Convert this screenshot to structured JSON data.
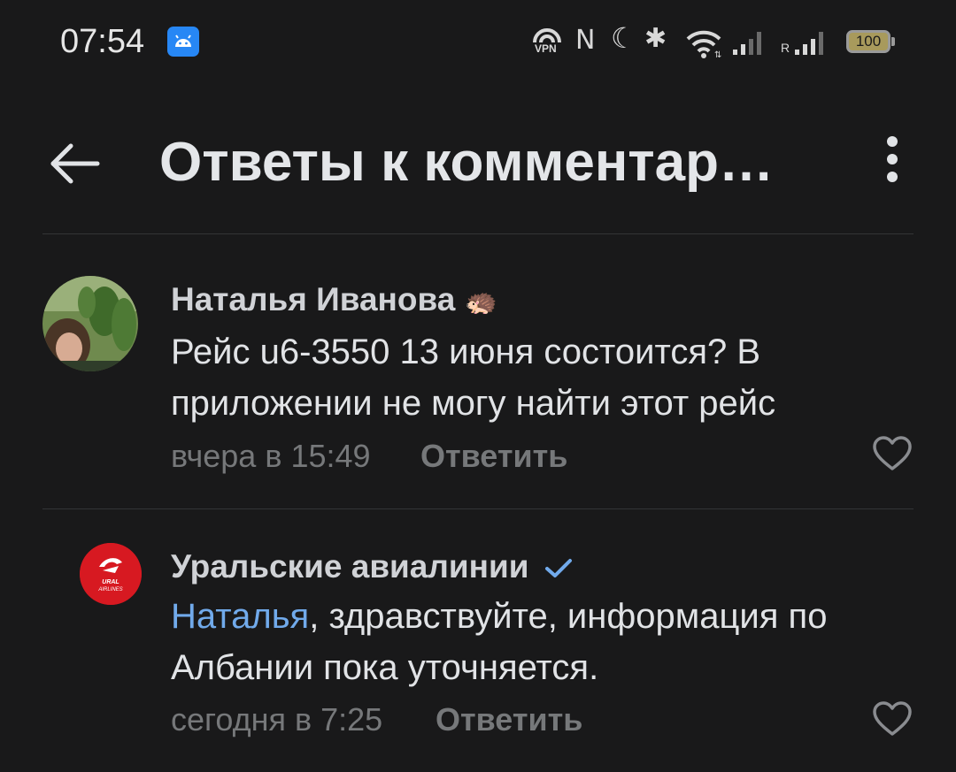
{
  "status_bar": {
    "time": "07:54",
    "vpn_label": "VPN",
    "nfc_glyph": "N",
    "moon_glyph": "☾",
    "bluetooth_glyph": "✱",
    "roaming_label": "R",
    "battery_level": "100",
    "icons": [
      "android-notification-icon",
      "vpn-icon",
      "nfc-icon",
      "do-not-disturb-icon",
      "bluetooth-icon",
      "wifi-icon",
      "signal-icon",
      "roaming-signal-icon",
      "battery-icon"
    ]
  },
  "header": {
    "title": "Ответы к комментарию",
    "back_icon": "arrow-left-icon",
    "more_icon": "more-vertical-icon"
  },
  "comments": [
    {
      "author": "Наталья Иванова",
      "author_emoji": "🦔",
      "text": "Рейс u6-3550 13 июня состоится? В приложении не могу найти этот рейс",
      "time": "вчера в 15:49",
      "reply_label": "Ответить",
      "like_icon": "heart-outline-icon"
    },
    {
      "author": "Уральские авиалинии",
      "verified_icon": "check-icon",
      "mention": "Наталья",
      "text": ", здравствуйте, информация по Албании пока уточняется.",
      "time": "сегодня в 7:25",
      "reply_label": "Ответить",
      "like_icon": "heart-outline-icon",
      "logo_text": "URAL AIRLINES",
      "logo_color": "#d71921"
    }
  ],
  "colors": {
    "background": "#19191a",
    "text": "#e1e3e6",
    "secondary_text": "#76787a",
    "link": "#71aaeb",
    "android_badge": "#2787f5"
  }
}
